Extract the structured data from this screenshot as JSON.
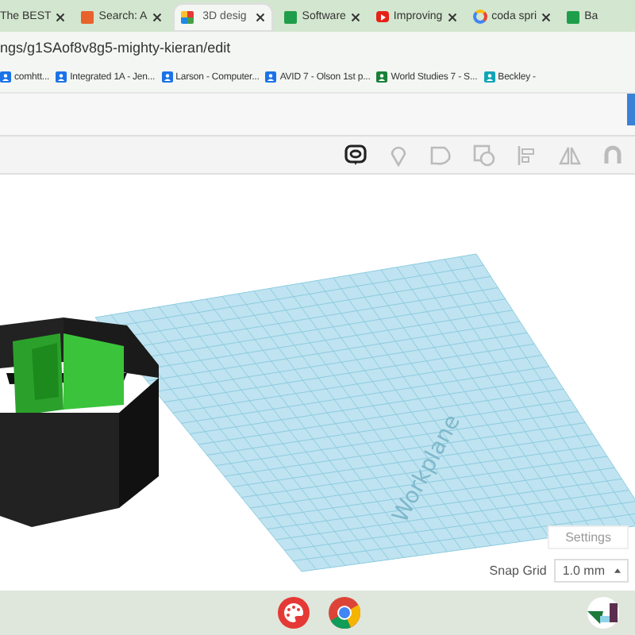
{
  "tabs": [
    {
      "title": "The BEST",
      "kind": "none",
      "selected": false
    },
    {
      "title": "Search: A",
      "kind": "search",
      "selected": false
    },
    {
      "title": "3D desig",
      "kind": "design",
      "selected": true
    },
    {
      "title": "Software",
      "kind": "sheet",
      "selected": false
    },
    {
      "title": "Improving",
      "kind": "video",
      "selected": false
    },
    {
      "title": "coda spri",
      "kind": "google",
      "selected": false
    },
    {
      "title": "Ba",
      "kind": "sheet",
      "selected": false
    }
  ],
  "address": "ngs/g1SAof8v8g5-mighty-kieran/edit",
  "bookmarks": [
    {
      "title": "comhtt..."
    },
    {
      "title": "Integrated 1A - Jen..."
    },
    {
      "title": "Larson - Computer..."
    },
    {
      "title": "AVID 7 - Olson 1st p..."
    },
    {
      "title": "World Studies 7 - S..."
    },
    {
      "title": "Beckley -"
    }
  ],
  "workplane": {
    "label": "Workplane"
  },
  "settings_button": "Settings",
  "snap_grid": {
    "label": "Snap Grid",
    "value": "1.0 mm"
  }
}
